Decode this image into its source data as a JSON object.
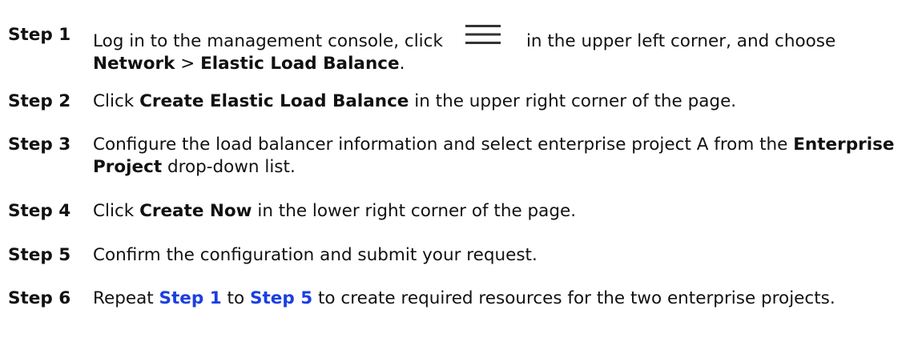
{
  "steps": [
    {
      "label": "Step 1",
      "parts": {
        "a": "Log in to the management console, click",
        "icon": "menu-icon",
        "b": "in the upper left corner, and choose ",
        "c": "Network",
        "d": " > ",
        "e": "Elastic Load Balance",
        "f": "."
      }
    },
    {
      "label": "Step 2",
      "parts": {
        "a": "Click ",
        "b": "Create Elastic Load Balance",
        "c": " in the upper right corner of the page."
      }
    },
    {
      "label": "Step 3",
      "parts": {
        "a": "Configure the load balancer information and select enterprise project A from the ",
        "b": "Enterprise Project",
        "c": " drop-down list."
      }
    },
    {
      "label": "Step 4",
      "parts": {
        "a": "Click ",
        "b": "Create Now",
        "c": " in the lower right corner of the page."
      }
    },
    {
      "label": "Step 5",
      "parts": {
        "a": "Confirm the configuration and submit your request."
      }
    },
    {
      "label": "Step 6",
      "parts": {
        "a": "Repeat ",
        "b": "Step 1",
        "c": " to ",
        "d": "Step 5",
        "e": " to create required resources for the two enterprise projects."
      }
    }
  ],
  "colors": {
    "text": "#111111",
    "link": "#1a3fe0"
  }
}
